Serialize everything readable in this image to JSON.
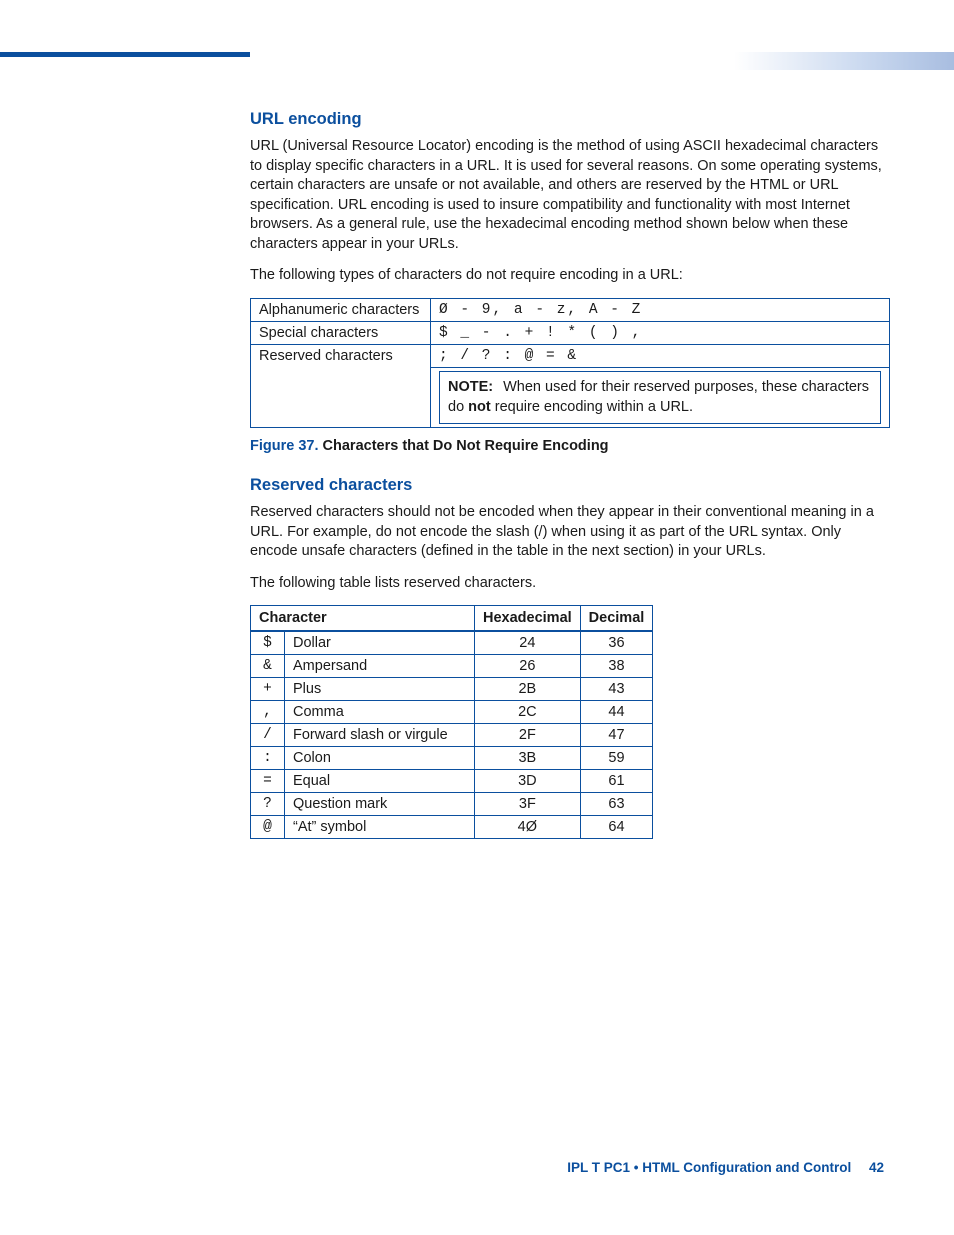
{
  "section1": {
    "heading": "URL encoding",
    "para1": "URL (Universal Resource Locator) encoding is the method of using ASCII hexadecimal characters to display specific characters in a URL. It is used for several reasons.  On some operating systems, certain characters are unsafe or not available, and others are reserved by the HTML or URL specification. URL encoding is used to insure compatibility and functionality with most Internet browsers. As a general rule, use the hexadecimal encoding method shown below when these characters appear in your URLs.",
    "para2": "The following types of characters do not require encoding in a URL:"
  },
  "table1": {
    "rows": [
      {
        "label": "Alphanumeric characters",
        "value": "Ø - 9, a - z, A - Z"
      },
      {
        "label": "Special characters",
        "value": "$ _ - . + ! * ( ) ,"
      },
      {
        "label": "Reserved characters",
        "value": "; / ? : @ = &"
      }
    ],
    "note": {
      "label": "NOTE:",
      "before": "When used for their reserved purposes, these characters do ",
      "bold": "not",
      "after": " require encoding within a URL."
    }
  },
  "figure37": {
    "num": "Figure 37.",
    "title": " Characters that Do Not Require Encoding"
  },
  "section2": {
    "heading": "Reserved characters",
    "para1": "Reserved characters should not be encoded when they appear in their conventional meaning in a URL. For example, do not encode the slash (/) when using it as part of the URL syntax. Only encode unsafe characters (defined in the table in the next section) in your URLs.",
    "para2": "The following table lists reserved characters."
  },
  "table2": {
    "headers": {
      "char": "Character",
      "hex": "Hexadecimal",
      "dec": "Decimal"
    },
    "rows": [
      {
        "sym": "$",
        "name": "Dollar",
        "hex": "24",
        "dec": "36"
      },
      {
        "sym": "&",
        "name": "Ampersand",
        "hex": "26",
        "dec": "38"
      },
      {
        "sym": "+",
        "name": "Plus",
        "hex": "2B",
        "dec": "43"
      },
      {
        "sym": ",",
        "name": "Comma",
        "hex": "2C",
        "dec": "44"
      },
      {
        "sym": "/",
        "name": "Forward slash or virgule",
        "hex": "2F",
        "dec": "47"
      },
      {
        "sym": ":",
        "name": "Colon",
        "hex": "3B",
        "dec": "59"
      },
      {
        "sym": "=",
        "name": "Equal",
        "hex": "3D",
        "dec": "61"
      },
      {
        "sym": "?",
        "name": "Question mark",
        "hex": "3F",
        "dec": "63"
      },
      {
        "sym": "@",
        "name": "“At” symbol",
        "hex": "4Ø",
        "dec": "64"
      }
    ]
  },
  "footer": {
    "text": "IPL T PC1 • HTML Configuration and Control",
    "page": "42"
  }
}
